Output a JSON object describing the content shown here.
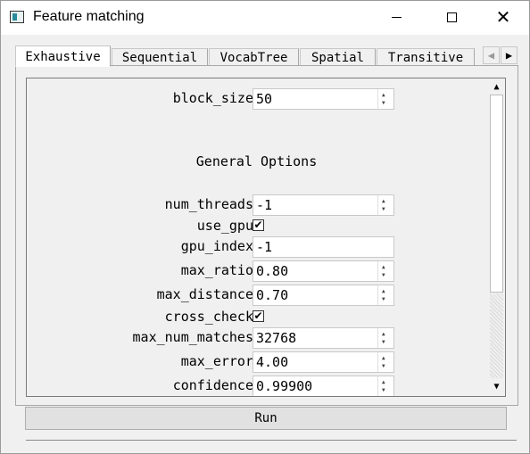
{
  "window": {
    "title": "Feature matching",
    "minimize_icon": "minimize-icon",
    "maximize_icon": "maximize-icon",
    "close_icon": "close-icon",
    "close_glyph": "✕"
  },
  "tabs": [
    {
      "label": "Exhaustive",
      "active": true
    },
    {
      "label": "Sequential",
      "active": false
    },
    {
      "label": "VocabTree",
      "active": false
    },
    {
      "label": "Spatial",
      "active": false
    },
    {
      "label": "Transitive",
      "active": false
    }
  ],
  "tab_scroll": {
    "left_glyph": "◀",
    "right_glyph": "▶"
  },
  "options": {
    "block_size": {
      "label": "block_size",
      "value": "50"
    },
    "general_title": "General Options",
    "num_threads": {
      "label": "num_threads",
      "value": "-1"
    },
    "use_gpu": {
      "label": "use_gpu",
      "checked": true
    },
    "gpu_index": {
      "label": "gpu_index",
      "value": "-1"
    },
    "max_ratio": {
      "label": "max_ratio",
      "value": "0.80"
    },
    "max_distance": {
      "label": "max_distance",
      "value": "0.70"
    },
    "cross_check": {
      "label": "cross_check",
      "checked": true
    },
    "max_num_matches": {
      "label": "max_num_matches",
      "value": "32768"
    },
    "max_error": {
      "label": "max_error",
      "value": "4.00"
    },
    "confidence": {
      "label": "confidence",
      "value": "0.99900"
    }
  },
  "check_glyph": "✔",
  "scrollbar": {
    "up_glyph": "▲",
    "down_glyph": "▼"
  },
  "run_label": "Run"
}
